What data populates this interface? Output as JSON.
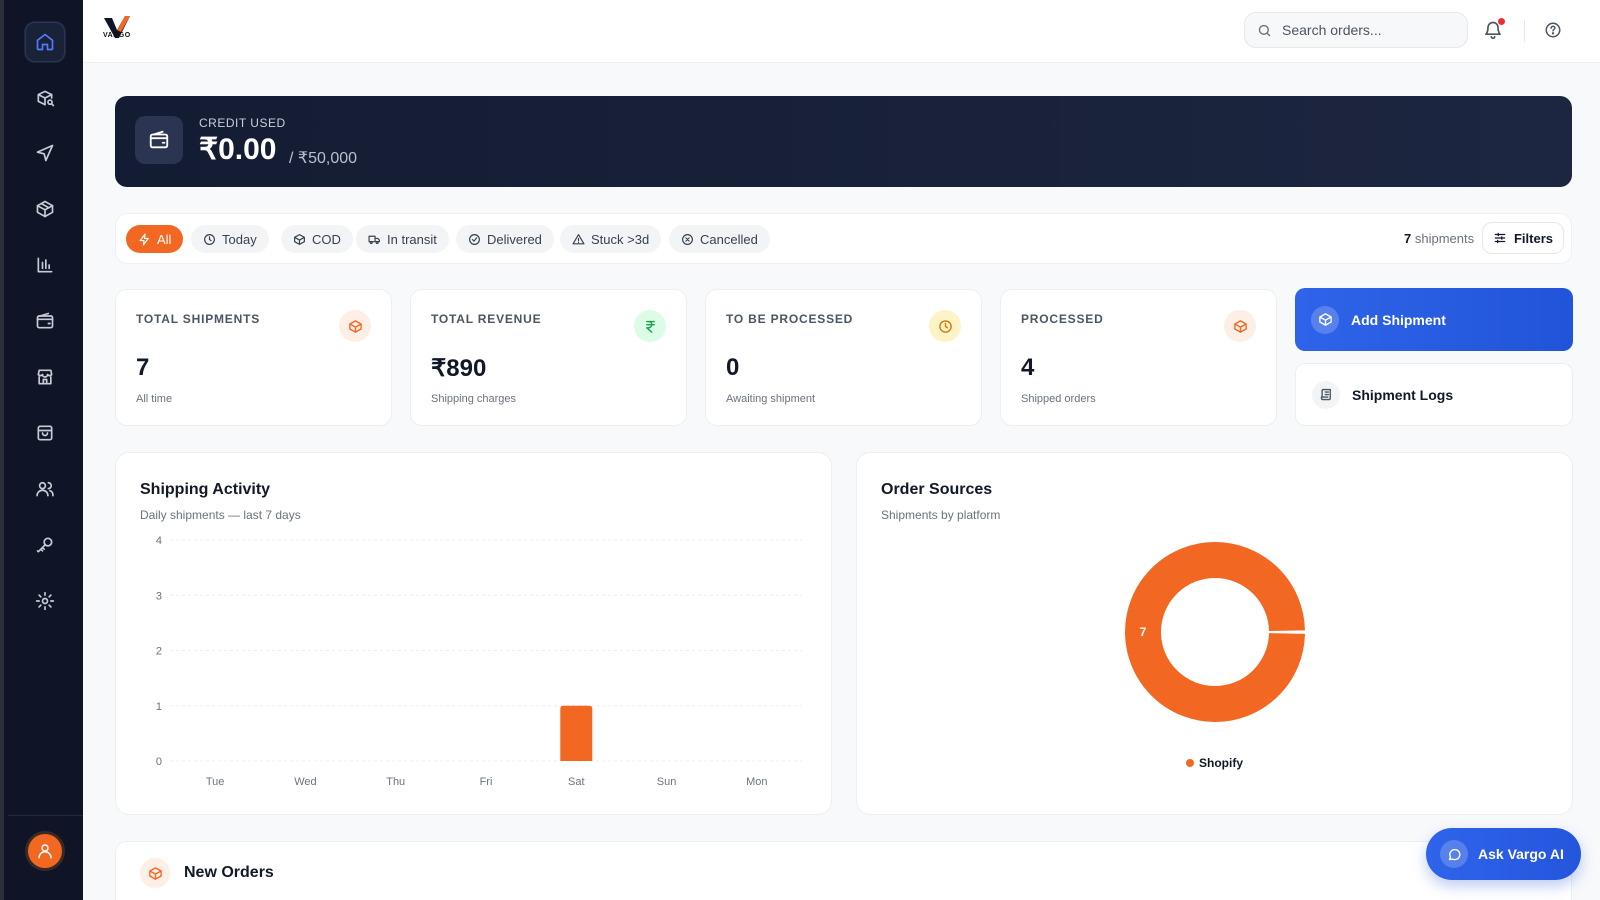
{
  "brand": {
    "logo_text": "VARGO"
  },
  "sidebar": {
    "items": [
      {
        "icon": "home-icon",
        "active": true
      },
      {
        "icon": "package-search-icon"
      },
      {
        "icon": "send-icon"
      },
      {
        "icon": "package-icon"
      },
      {
        "icon": "bar-chart-icon"
      },
      {
        "icon": "wallet-icon"
      },
      {
        "icon": "store-icon"
      },
      {
        "icon": "shopping-bag-icon"
      },
      {
        "icon": "users-icon"
      },
      {
        "icon": "key-icon"
      },
      {
        "icon": "settings-icon"
      }
    ]
  },
  "header": {
    "search_placeholder": "Search orders...",
    "notification_unread": true
  },
  "credit": {
    "label": "CREDIT USED",
    "amount": "₹0.00",
    "limit": "/ ₹50,000"
  },
  "filters": {
    "chips": [
      {
        "label": "All",
        "icon": "bolt-icon",
        "active": true
      },
      {
        "label": "Today",
        "icon": "clock-icon"
      },
      {
        "label": "COD",
        "icon": "box-icon"
      },
      {
        "label": "In transit",
        "icon": "truck-icon"
      },
      {
        "label": "Delivered",
        "icon": "check-circle-icon"
      },
      {
        "label": "Stuck >3d",
        "icon": "warning-icon"
      },
      {
        "label": "Cancelled",
        "icon": "x-circle-icon"
      }
    ],
    "count_number": "7",
    "count_label": "shipments",
    "filters_label": "Filters"
  },
  "stats": [
    {
      "label": "TOTAL SHIPMENTS",
      "value": "7",
      "sub": "All time",
      "icon": "package-icon",
      "icon_bg": "#fdeee6",
      "icon_color": "#f26822"
    },
    {
      "label": "TOTAL REVENUE",
      "value": "₹890",
      "sub": "Shipping charges",
      "icon": "rupee-icon",
      "icon_bg": "#dcfce7",
      "icon_color": "#16a34a"
    },
    {
      "label": "TO BE PROCESSED",
      "value": "0",
      "sub": "Awaiting shipment",
      "icon": "clock-icon",
      "icon_bg": "#fef3c7",
      "icon_color": "#d97706"
    },
    {
      "label": "PROCESSED",
      "value": "4",
      "sub": "Shipped orders",
      "icon": "package-icon",
      "icon_bg": "#fdeee6",
      "icon_color": "#f26822"
    }
  ],
  "actions": {
    "add_shipment": "Add Shipment",
    "shipment_logs": "Shipment Logs"
  },
  "shipping_activity": {
    "title": "Shipping Activity",
    "subtitle": "Daily shipments — last 7 days"
  },
  "order_sources": {
    "title": "Order Sources",
    "subtitle": "Shipments by platform"
  },
  "new_orders": {
    "title": "New Orders"
  },
  "ask_ai": {
    "label": "Ask Vargo AI"
  },
  "colors": {
    "accent": "#f26822",
    "primary": "#2f64ea",
    "sidebar": "#0f1527"
  },
  "chart_data": [
    {
      "type": "bar",
      "categories": [
        "Tue",
        "Wed",
        "Thu",
        "Fri",
        "Sat",
        "Sun",
        "Mon"
      ],
      "values": [
        0,
        0,
        0,
        0,
        1,
        0,
        0
      ],
      "ylim": [
        0,
        4
      ],
      "yticks": [
        0,
        1,
        2,
        3,
        4
      ],
      "grid": true,
      "color": "#f26822"
    },
    {
      "type": "pie",
      "donut": true,
      "labels": [
        "Shopify"
      ],
      "values": [
        7
      ],
      "colors": [
        "#f26822"
      ],
      "legend": "bottom"
    }
  ]
}
